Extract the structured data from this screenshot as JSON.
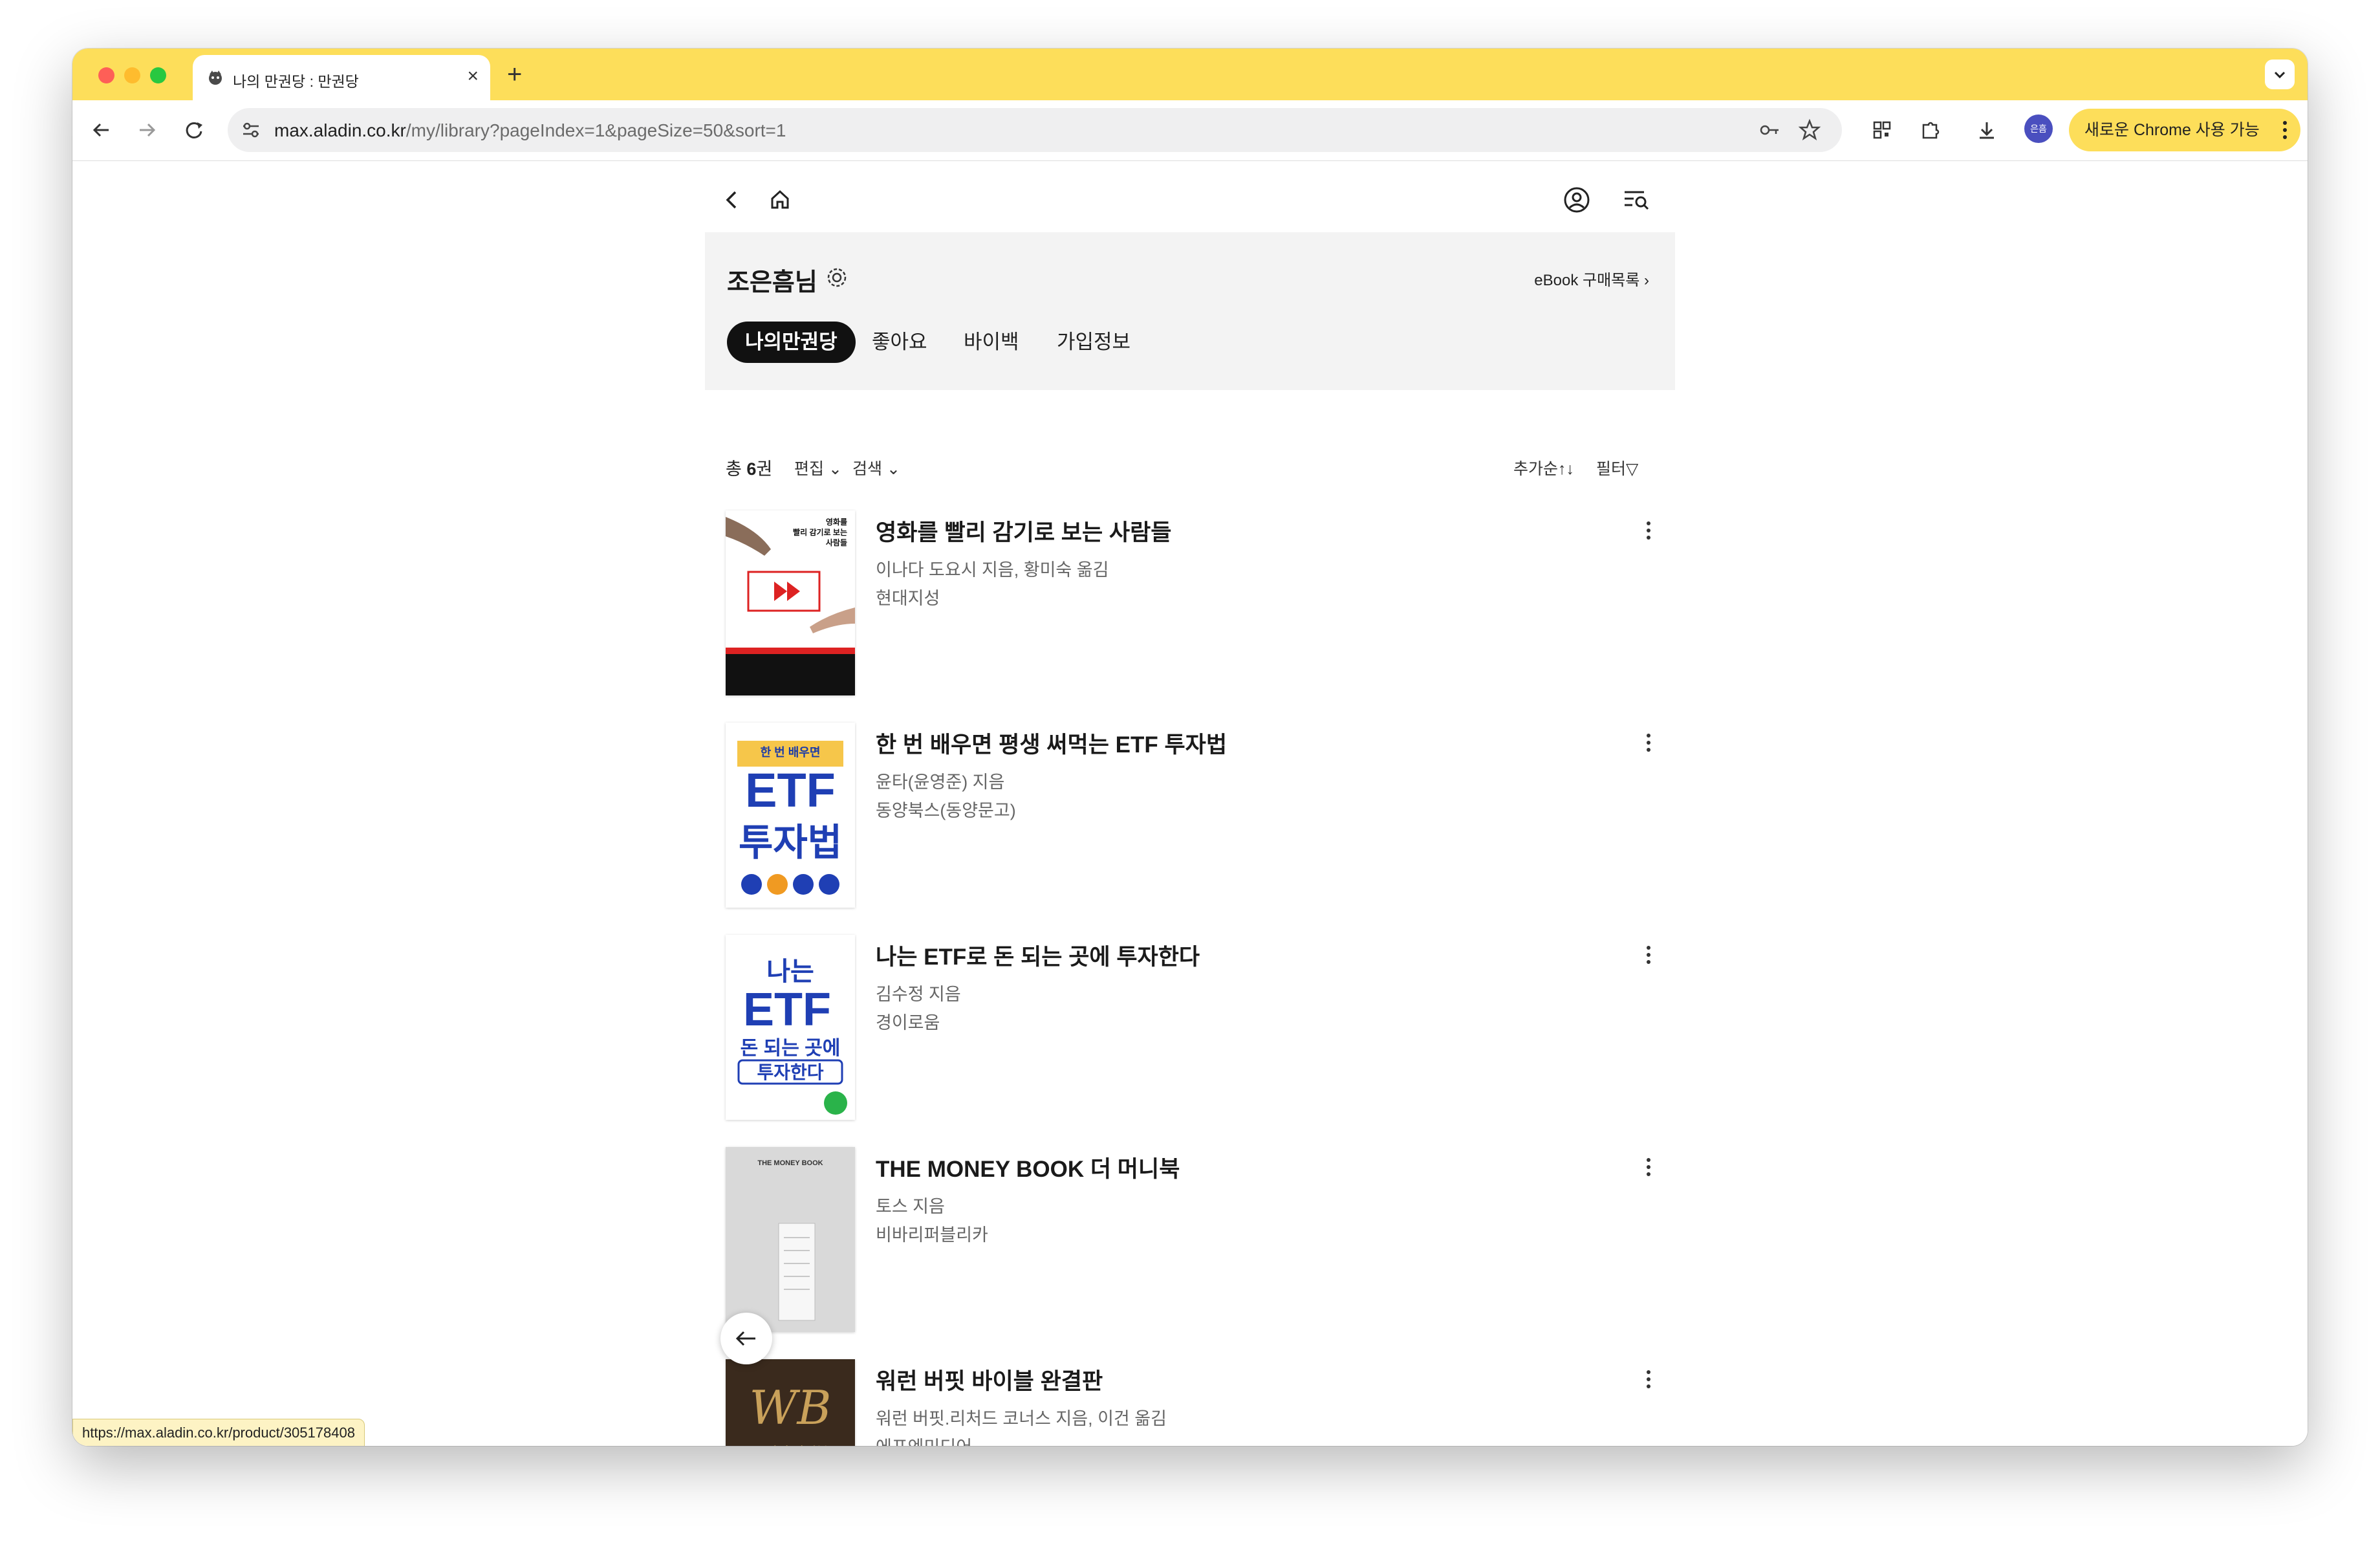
{
  "browser": {
    "tab_title": "나의 만권당 : 만권당",
    "url_host": "max.aladin.co.kr",
    "url_path": "/my/library?pageIndex=1&pageSize=50&sort=1",
    "profile_initials": "은흠",
    "chrome_pill_label": "새로운 Chrome 사용 가능",
    "status_url": "https://max.aladin.co.kr/product/305178408"
  },
  "profile": {
    "name": "조은흠님",
    "ebook_link": "eBook 구매목록"
  },
  "tabs": [
    {
      "label": "나의만권당",
      "active": true
    },
    {
      "label": "좋아요",
      "active": false
    },
    {
      "label": "바이백",
      "active": false
    },
    {
      "label": "가입정보",
      "active": false
    }
  ],
  "list_header": {
    "total_prefix": "총 ",
    "total_count": "6",
    "total_suffix": "권",
    "edit_label": "편집",
    "search_label": "검색",
    "sort_label": "추가순",
    "filter_label": "필터"
  },
  "books": [
    {
      "title": "영화를 빨리 감기로 보는 사람들",
      "author": "이나다 도요시 지음, 황미숙 옮김",
      "publisher": "현대지성",
      "cover": {
        "bg": "#ffffff",
        "text": "영화를\n빨리 감기로 보는\n사람들"
      }
    },
    {
      "title": "한 번 배우면 평생 써먹는 ETF 투자법",
      "author": "윤타(윤영준) 지음",
      "publisher": "동양북스(동양문고)",
      "cover": {
        "bg": "#ffffff",
        "text": "ETF\n투자법"
      }
    },
    {
      "title": "나는 ETF로 돈 되는 곳에 투자한다",
      "author": "김수정 지음",
      "publisher": "경이로움",
      "cover": {
        "bg": "#ffffff",
        "text": "ETF"
      }
    },
    {
      "title": "THE MONEY BOOK 더 머니북",
      "author": "토스 지음",
      "publisher": "비바리퍼블리카",
      "cover": {
        "bg": "#d9d9d9",
        "text": "THE MONEY BOOK"
      }
    },
    {
      "title": "워런 버핏 바이블 완결판",
      "author": "워런 버핏.리처드 코너스 지음, 이건 옮김",
      "publisher": "에프엔미디어",
      "cover": {
        "bg": "#3a2a1d",
        "text": "WB"
      }
    }
  ],
  "colors": {
    "brand_yellow": "#fdde5a",
    "active_tab": "#111111",
    "card_bg": "#f3f3f3"
  }
}
